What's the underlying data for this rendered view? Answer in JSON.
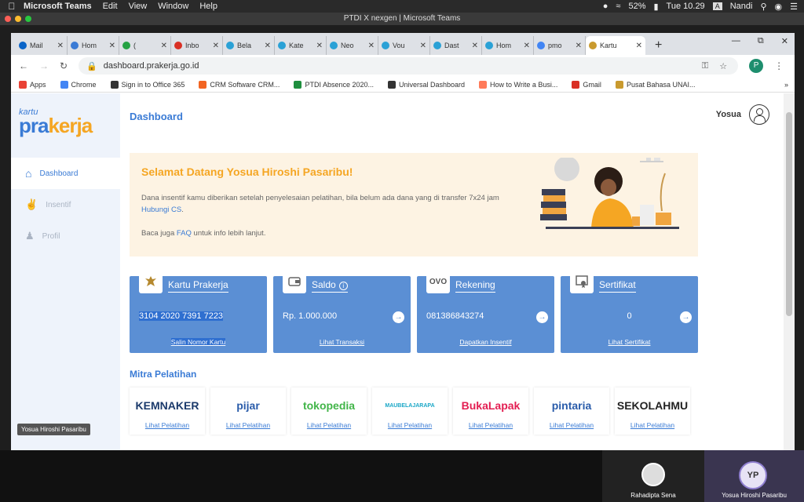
{
  "menubar": {
    "app": "Microsoft Teams",
    "items": [
      "Edit",
      "View",
      "Window",
      "Help"
    ],
    "battery": "52%",
    "clock": "Tue 10.29",
    "user": "Nandi"
  },
  "teams_title": "PTDI X nexgen | Microsoft Teams",
  "browser": {
    "tabs": [
      {
        "label": "Mail",
        "color": "#0a64c8"
      },
      {
        "label": "Hom",
        "color": "#3a7bd5"
      },
      {
        "label": "(",
        "color": "#25a244"
      },
      {
        "label": "Inbo",
        "color": "#d93025"
      },
      {
        "label": "Bela",
        "color": "#2aa1d6"
      },
      {
        "label": "Kate",
        "color": "#2aa1d6"
      },
      {
        "label": "Neo",
        "color": "#2aa1d6"
      },
      {
        "label": "Vou",
        "color": "#2aa1d6"
      },
      {
        "label": "Dast",
        "color": "#2aa1d6"
      },
      {
        "label": "Hom",
        "color": "#2aa1d6"
      },
      {
        "label": "pmo",
        "color": "#4285f4"
      }
    ],
    "active_tab": "Kartu",
    "url": "dashboard.prakerja.go.id",
    "profile_initial": "P",
    "bookmarks": [
      {
        "label": "Apps",
        "color": "#e94235"
      },
      {
        "label": "Chrome",
        "color": "#4285f4"
      },
      {
        "label": "Sign in to Office 365",
        "color": "#333333"
      },
      {
        "label": "CRM Software CRM...",
        "color": "#f26522"
      },
      {
        "label": "PTDI Absence 2020...",
        "color": "#1e8e3e"
      },
      {
        "label": "Universal Dashboard",
        "color": "#333333"
      },
      {
        "label": "How to Write a Busi...",
        "color": "#ff7a59"
      },
      {
        "label": "Gmail",
        "color": "#d93025"
      },
      {
        "label": "Pusat Bahasa UNAI...",
        "color": "#c99a2e"
      }
    ],
    "more": "»"
  },
  "sidebar": {
    "logo_top": "kartu",
    "logo_main_a": "pra",
    "logo_main_b": "kerja",
    "items": [
      {
        "label": "Dashboard"
      },
      {
        "label": "Insentif"
      },
      {
        "label": "Profil"
      }
    ],
    "presenter_tag": "Yosua Hiroshi Pasaribu"
  },
  "main": {
    "title": "Dashboard",
    "username": "Yosua",
    "welcome": {
      "heading": "Selamat Datang Yosua Hiroshi Pasaribu!",
      "p1_a": "Dana insentif kamu diberikan setelah penyelesaian pelatihan, bila belum ada dana yang di transfer 7x24 jam ",
      "p1_link": "Hubungi CS",
      "p1_b": ".",
      "p2_a": "Baca juga ",
      "p2_link": "FAQ",
      "p2_b": " untuk info lebih lanjut."
    },
    "cards": [
      {
        "title": "Kartu Prakerja",
        "value": "3104 2020 7391 7223",
        "link": "Salin Nomor Kartu",
        "icon": "garuda-icon"
      },
      {
        "title": "Saldo",
        "value": "Rp. 1.000.000",
        "link": "Lihat Transaksi",
        "icon": "wallet-icon"
      },
      {
        "title": "Rekening",
        "value": "081386843274",
        "link": "Dapatkan Insentif",
        "icon_text": "OVO"
      },
      {
        "title": "Sertifikat",
        "value": "0",
        "link": "Lihat Sertifikat",
        "icon": "certificate-icon"
      }
    ],
    "mitra_title": "Mitra Pelatihan",
    "partners": [
      {
        "name": "KEMNAKER",
        "color": "#1b3a6b",
        "link": "Lihat Pelatihan"
      },
      {
        "name": "pijar",
        "color": "#2a5caa",
        "link": "Lihat Pelatihan"
      },
      {
        "name": "tokopedia",
        "color": "#42b549",
        "link": "Lihat Pelatihan"
      },
      {
        "name": "MAUBELAJARAPA",
        "color": "#1aa7c7",
        "link": "Lihat Pelatihan"
      },
      {
        "name": "BukaLapak",
        "color": "#e31e52",
        "link": "Lihat Pelatihan"
      },
      {
        "name": "pintaria",
        "color": "#2a5caa",
        "link": "Lihat Pelatihan"
      },
      {
        "name": "SEKOLAHMU",
        "color": "#222222",
        "link": "Lihat Pelatihan"
      }
    ]
  },
  "participants": [
    {
      "name": "Rahadipta Sena"
    },
    {
      "name": "Yosua Hiroshi Pasaribu",
      "initials": "YP"
    }
  ]
}
